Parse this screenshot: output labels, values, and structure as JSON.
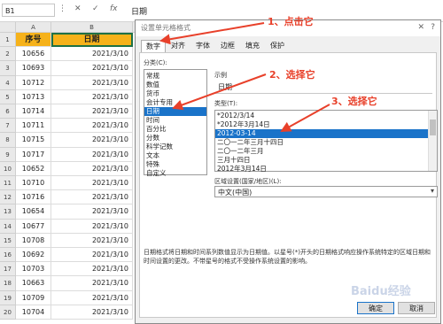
{
  "formula_bar": {
    "cell_ref": "B1",
    "formula": "日期"
  },
  "sheet": {
    "columns": [
      "A",
      "B",
      "C"
    ],
    "headers": [
      "序号",
      "日期"
    ],
    "rows": [
      [
        "10656",
        "2021/3/10"
      ],
      [
        "10693",
        "2021/3/10"
      ],
      [
        "10712",
        "2021/3/10"
      ],
      [
        "10713",
        "2021/3/10"
      ],
      [
        "10714",
        "2021/3/10"
      ],
      [
        "10711",
        "2021/3/10"
      ],
      [
        "10715",
        "2021/3/10"
      ],
      [
        "10717",
        "2021/3/10"
      ],
      [
        "10652",
        "2021/3/10"
      ],
      [
        "10710",
        "2021/3/10"
      ],
      [
        "10716",
        "2021/3/10"
      ],
      [
        "10654",
        "2021/3/10"
      ],
      [
        "10677",
        "2021/3/10"
      ],
      [
        "10708",
        "2021/3/10"
      ],
      [
        "10692",
        "2021/3/10"
      ],
      [
        "10703",
        "2021/3/10"
      ],
      [
        "10663",
        "2021/3/10"
      ],
      [
        "10709",
        "2021/3/10"
      ],
      [
        "10704",
        "2021/3/10"
      ]
    ],
    "row_numbers": [
      "1",
      "2",
      "3",
      "4",
      "5",
      "6",
      "7",
      "8",
      "9",
      "10",
      "11",
      "12",
      "13",
      "14",
      "15",
      "16",
      "17",
      "18",
      "19",
      "20"
    ]
  },
  "dialog": {
    "title": "设置单元格格式",
    "tabs": [
      "数字",
      "对齐",
      "字体",
      "边框",
      "填充",
      "保护"
    ],
    "category_label": "分类(C):",
    "categories": [
      "常规",
      "数值",
      "货币",
      "会计专用",
      "日期",
      "时间",
      "百分比",
      "分数",
      "科学记数",
      "文本",
      "特殊",
      "自定义"
    ],
    "selected_category": 4,
    "sample_label": "示例",
    "sample_value": "日期",
    "type_label": "类型(T):",
    "types": [
      "*2012/3/14",
      "*2012年3月14日",
      "2012-03-14",
      "二〇一二年三月十四日",
      "二〇一二年三月",
      "三月十四日",
      "2012年3月14日"
    ],
    "selected_type": 2,
    "locale_label": "区域设置(国家/地区)(L):",
    "locale_value": "中文(中国)",
    "description": "日期格式将日期和时间系列数值显示为日期值。以星号(*)开头的日期格式响应操作系统特定的区域日期和时间设置的更改。不带星号的格式不受操作系统设置的影响。",
    "ok_label": "确定",
    "cancel_label": "取消"
  },
  "annotations": {
    "step1": "1、点击它",
    "step2": "2、选择它",
    "step3": "3、选择它",
    "color": "#e8402a"
  },
  "watermark": "Baidu经验"
}
